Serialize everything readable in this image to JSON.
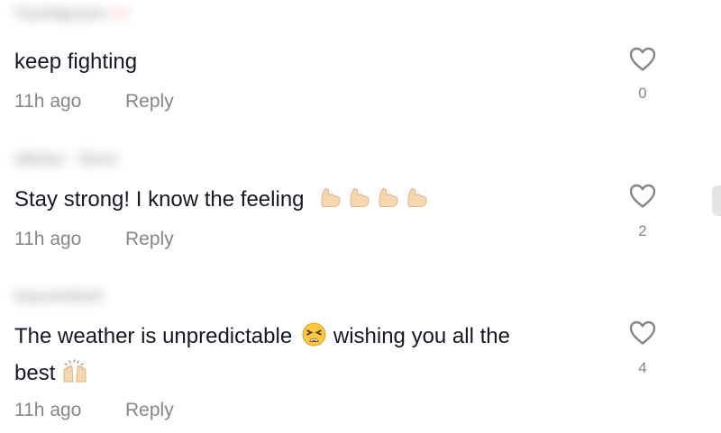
{
  "comments": [
    {
      "username": "TuanNguyen",
      "username_suffix": "♥ ♥",
      "text": "keep fighting",
      "time": "11h ago",
      "reply_label": "Reply",
      "likes": "0"
    },
    {
      "username": "2Moby♡ Beck",
      "text_before": "Stay strong! I know the feeling",
      "emoji_icon": "flexed-biceps-icon",
      "emoji_count": 4,
      "time": "11h ago",
      "reply_label": "Reply",
      "likes": "2"
    },
    {
      "username": "bayumidash",
      "text_part1": "The weather is unpredictable",
      "emoji1_icon": "tired-face-icon",
      "text_part2": "wishing you all the",
      "text_part3": "best",
      "emoji2_icon": "raising-hands-icon",
      "time": "11h ago",
      "reply_label": "Reply",
      "likes": "4"
    }
  ],
  "colors": {
    "text": "#161823",
    "meta": "#86878b",
    "icon": "#86878b",
    "emoji_skin": "#f5d7b0"
  }
}
